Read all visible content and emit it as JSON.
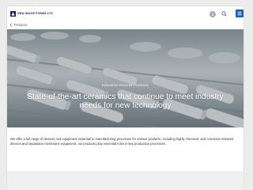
{
  "header": {
    "logo_text": "NEW IMAGE FORMS LTD",
    "brand_color": "#1c5fb8"
  },
  "breadcrumb": {
    "label": "Products"
  },
  "hero": {
    "eyebrow": "Industrial Process Products",
    "title": "State-of-the-art ceramics that continue to meet industry needs for new technology"
  },
  "intro": {
    "text": "We offer a full range of devices and equipment essential to manufacturing processes for various products, including highly chemical- and corrosion-resistant devices and separation membrane equipment, our products play essential roles in key production processes."
  },
  "icons": {
    "globe": "globe-icon",
    "search": "search-icon",
    "menu": "menu-icon",
    "back": "chevron-left-icon"
  }
}
